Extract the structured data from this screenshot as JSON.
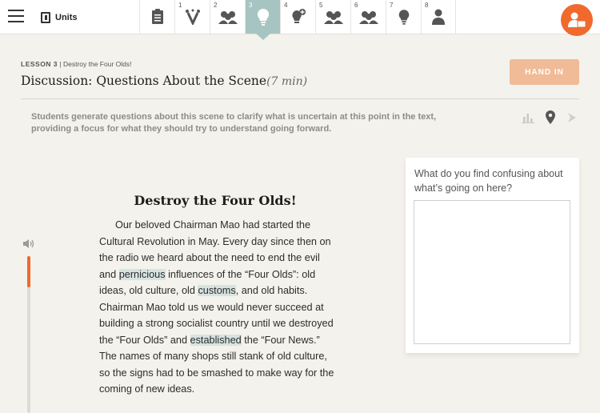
{
  "header": {
    "units_label": "Units",
    "steps": [
      {
        "num": "",
        "icon": "clipboard-icon"
      },
      {
        "num": "1",
        "icon": "vocab-icon"
      },
      {
        "num": "2",
        "icon": "group-icon"
      },
      {
        "num": "3",
        "icon": "lightbulb-icon",
        "active": true
      },
      {
        "num": "4",
        "icon": "lightbulb-plus-icon"
      },
      {
        "num": "5",
        "icon": "group-icon"
      },
      {
        "num": "6",
        "icon": "group-icon"
      },
      {
        "num": "7",
        "icon": "lightbulb-icon"
      },
      {
        "num": "8",
        "icon": "person-icon"
      }
    ],
    "accent_color": "#ef6a2c",
    "active_step_color": "#a6c4c1"
  },
  "lesson": {
    "label_prefix": "LESSON 3",
    "label_suffix": " | Destroy the Four Olds!",
    "title": "Discussion: Questions About the Scene",
    "time": "(7 min)",
    "hand_in_label": "HAND IN",
    "description": "Students generate questions about this scene to clarify what is uncertain at this point in the text, providing a focus for what they should try to understand going forward."
  },
  "reading": {
    "title": "Destroy the Four Olds!",
    "progress": 0.2,
    "paragraph": {
      "t1": "Our beloved Chairman Mao had started the Cultural Revolution in May. Every day since then on the radio we heard about the need to end the evil and ",
      "w1": "pernicious",
      "t2": " influences of the “Four Olds”: old ideas, old culture, old ",
      "w2": "customs",
      "t3": ", and old habits. Chairman Mao told us we would never succeed at building a strong socialist country until we destroyed the “Four Olds” and ",
      "w3": "established",
      "t4": " the “Four News.” The names of many shops still stank of old culture, so the signs had to be smashed to make way for the coming of new ideas."
    }
  },
  "question": {
    "prompt": "What do you find confusing about what’s going on here?",
    "answer": ""
  }
}
